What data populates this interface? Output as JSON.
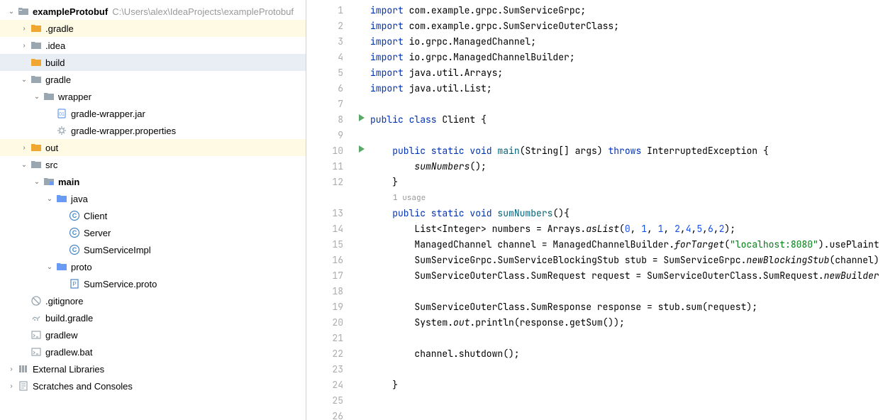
{
  "project": {
    "name": "exampleProtobuf",
    "path": "C:\\Users\\alex\\IdeaProjects\\exampleProtobuf"
  },
  "tree": [
    {
      "depth": 0,
      "chevron": "v",
      "icon": "project",
      "label": "exampleProtobuf",
      "bold": true,
      "path": "C:\\Users\\alex\\IdeaProjects\\exampleProtobuf"
    },
    {
      "depth": 1,
      "chevron": ">",
      "icon": "folder-orange",
      "label": ".gradle",
      "hl": "yellow"
    },
    {
      "depth": 1,
      "chevron": ">",
      "icon": "folder-gray",
      "label": ".idea"
    },
    {
      "depth": 1,
      "chevron": "",
      "icon": "folder-orange",
      "label": "build",
      "hl": "selected"
    },
    {
      "depth": 1,
      "chevron": "v",
      "icon": "folder-gray",
      "label": "gradle"
    },
    {
      "depth": 2,
      "chevron": "v",
      "icon": "folder-gray",
      "label": "wrapper"
    },
    {
      "depth": 3,
      "chevron": "",
      "icon": "jar",
      "label": "gradle-wrapper.jar"
    },
    {
      "depth": 3,
      "chevron": "",
      "icon": "gear",
      "label": "gradle-wrapper.properties"
    },
    {
      "depth": 1,
      "chevron": ">",
      "icon": "folder-orange",
      "label": "out",
      "hl": "yellow"
    },
    {
      "depth": 1,
      "chevron": "v",
      "icon": "folder-gray",
      "label": "src"
    },
    {
      "depth": 2,
      "chevron": "v",
      "icon": "module",
      "label": "main",
      "bold": true
    },
    {
      "depth": 3,
      "chevron": "v",
      "icon": "folder-blue",
      "label": "java"
    },
    {
      "depth": 4,
      "chevron": "",
      "icon": "class",
      "label": "Client"
    },
    {
      "depth": 4,
      "chevron": "",
      "icon": "class",
      "label": "Server"
    },
    {
      "depth": 4,
      "chevron": "",
      "icon": "class",
      "label": "SumServiceImpl"
    },
    {
      "depth": 3,
      "chevron": "v",
      "icon": "folder-blue",
      "label": "proto"
    },
    {
      "depth": 4,
      "chevron": "",
      "icon": "proto",
      "label": "SumService.proto"
    },
    {
      "depth": 1,
      "chevron": "",
      "icon": "gitignore",
      "label": ".gitignore"
    },
    {
      "depth": 1,
      "chevron": "",
      "icon": "gradle",
      "label": "build.gradle"
    },
    {
      "depth": 1,
      "chevron": "",
      "icon": "shell",
      "label": "gradlew"
    },
    {
      "depth": 1,
      "chevron": "",
      "icon": "shell",
      "label": "gradlew.bat"
    },
    {
      "depth": 0,
      "chevron": ">",
      "icon": "lib",
      "label": "External Libraries"
    },
    {
      "depth": 0,
      "chevron": ">",
      "icon": "scratch",
      "label": "Scratches and Consoles"
    }
  ],
  "code": {
    "usage_label": "1 usage",
    "lines": [
      {
        "n": 1,
        "html": "<span class='kw'>import</span> com.example.grpc.SumServiceGrpc;"
      },
      {
        "n": 2,
        "html": "<span class='kw'>import</span> com.example.grpc.SumServiceOuterClass;"
      },
      {
        "n": 3,
        "html": "<span class='kw'>import</span> io.grpc.ManagedChannel;"
      },
      {
        "n": 4,
        "html": "<span class='kw'>import</span> io.grpc.ManagedChannelBuilder;"
      },
      {
        "n": 5,
        "html": "<span class='kw'>import</span> java.util.Arrays;"
      },
      {
        "n": 6,
        "html": "<span class='kw'>import</span> java.util.List;"
      },
      {
        "n": 7,
        "html": ""
      },
      {
        "n": 8,
        "run": true,
        "html": "<span class='kw'>public class</span> Client {"
      },
      {
        "n": 9,
        "html": ""
      },
      {
        "n": 10,
        "run": true,
        "html": "    <span class='kw'>public static void</span> <span class='fn'>main</span>(String[] args) <span class='kw'>throws</span> InterruptedException {"
      },
      {
        "n": 11,
        "html": "        <span class='it'>sumNumbers</span>();"
      },
      {
        "n": 12,
        "html": "    }"
      },
      {
        "n": "usage"
      },
      {
        "n": 13,
        "html": "    <span class='kw'>public static void</span> <span class='fn'>sumNumbers</span>(){"
      },
      {
        "n": 14,
        "html": "        List&lt;Integer&gt; numbers = Arrays.<span class='it'>asList</span>(<span class='num'>0</span>, <span class='num'>1</span>, <span class='num'>1</span>, <span class='num'>2</span>,<span class='num'>4</span>,<span class='num'>5</span>,<span class='num'>6</span>,<span class='num'>2</span>);"
      },
      {
        "n": 15,
        "html": "        ManagedChannel channel = ManagedChannelBuilder.<span class='it'>forTarget</span>(<span class='str'>\"localhost:8080\"</span>).usePlaint"
      },
      {
        "n": 16,
        "html": "        SumServiceGrpc.SumServiceBlockingStub stub = SumServiceGrpc.<span class='it'>newBlockingStub</span>(channel)"
      },
      {
        "n": 17,
        "html": "        SumServiceOuterClass.SumRequest request = SumServiceOuterClass.SumRequest.<span class='it'>newBuilder</span>"
      },
      {
        "n": 18,
        "html": ""
      },
      {
        "n": 19,
        "html": "        SumServiceOuterClass.SumResponse response = stub.sum(request);"
      },
      {
        "n": 20,
        "html": "        System.<span class='it'>out</span>.println(response.getSum());"
      },
      {
        "n": 21,
        "html": ""
      },
      {
        "n": 22,
        "html": "        channel.shutdown();"
      },
      {
        "n": 23,
        "html": ""
      },
      {
        "n": 24,
        "html": "    }"
      },
      {
        "n": 25,
        "html": ""
      },
      {
        "n": 26,
        "html": ""
      }
    ]
  }
}
